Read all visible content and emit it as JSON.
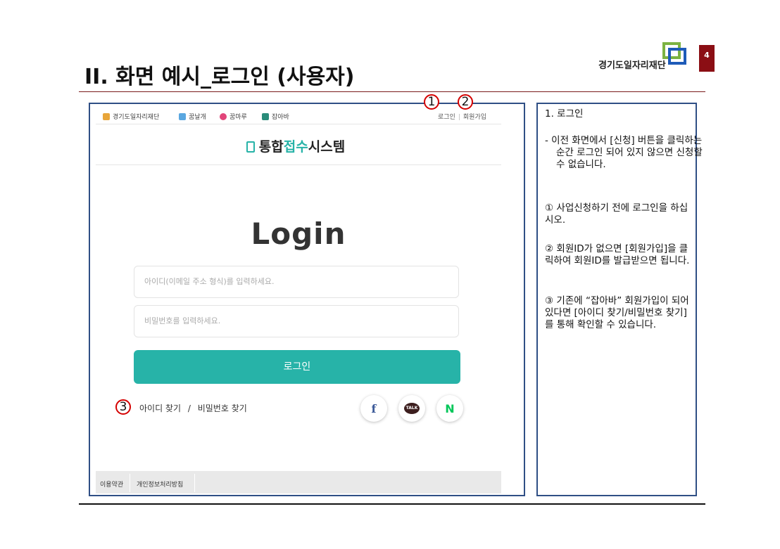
{
  "slide": {
    "title": "II. 화면 예시_로그인 (사용자)",
    "org_name": "경기도일자리재단",
    "page_number": "4"
  },
  "screenshot": {
    "topnav": {
      "links": [
        "경기도일자리재단",
        "꿈날개",
        "꿈마루",
        "잡아바"
      ],
      "login": "로그인",
      "signup": "회원가입"
    },
    "brand": {
      "part1": "통합",
      "part2": "접수",
      "part3": "시스템"
    },
    "login_title": "Login",
    "id_placeholder": "아이디(이메일 주소 형식)를 입력하세요.",
    "pw_placeholder": "비밀번호를 입력하세요.",
    "login_button": "로그인",
    "find_id": "아이디 찾기",
    "find_sep": "/",
    "find_pw": "비밀번호 찾기",
    "social": {
      "facebook": "f",
      "kakao": "TALK",
      "naver": "N"
    },
    "footer": {
      "terms": "이용약관",
      "privacy": "개인정보처리방침"
    },
    "markers": [
      "1",
      "2",
      "3"
    ]
  },
  "description": {
    "heading": "1.  로그인",
    "note": "-  이전 화면에서 [신청] 버튼을 클릭하는 순간 로그인 되어 있지 않으면 신청할 수 없습니다.",
    "item1": "① 사업신청하기 전에 로그인을 하십시오.",
    "item2": "② 회원ID가 없으면 [회원가입]을 클릭하여 회원ID를 발급받으면 됩니다.",
    "item3": "③ 기존에 “잡아바” 회원가입이 되어있다면 [아이디 찾기/비밀번호 찾기]를 통해 확인할 수 있습니다."
  },
  "colors": {
    "accent": "#27b3a8",
    "frame": "#2f4f85",
    "page_badge": "#8b0e14",
    "marker": "#d40000"
  }
}
